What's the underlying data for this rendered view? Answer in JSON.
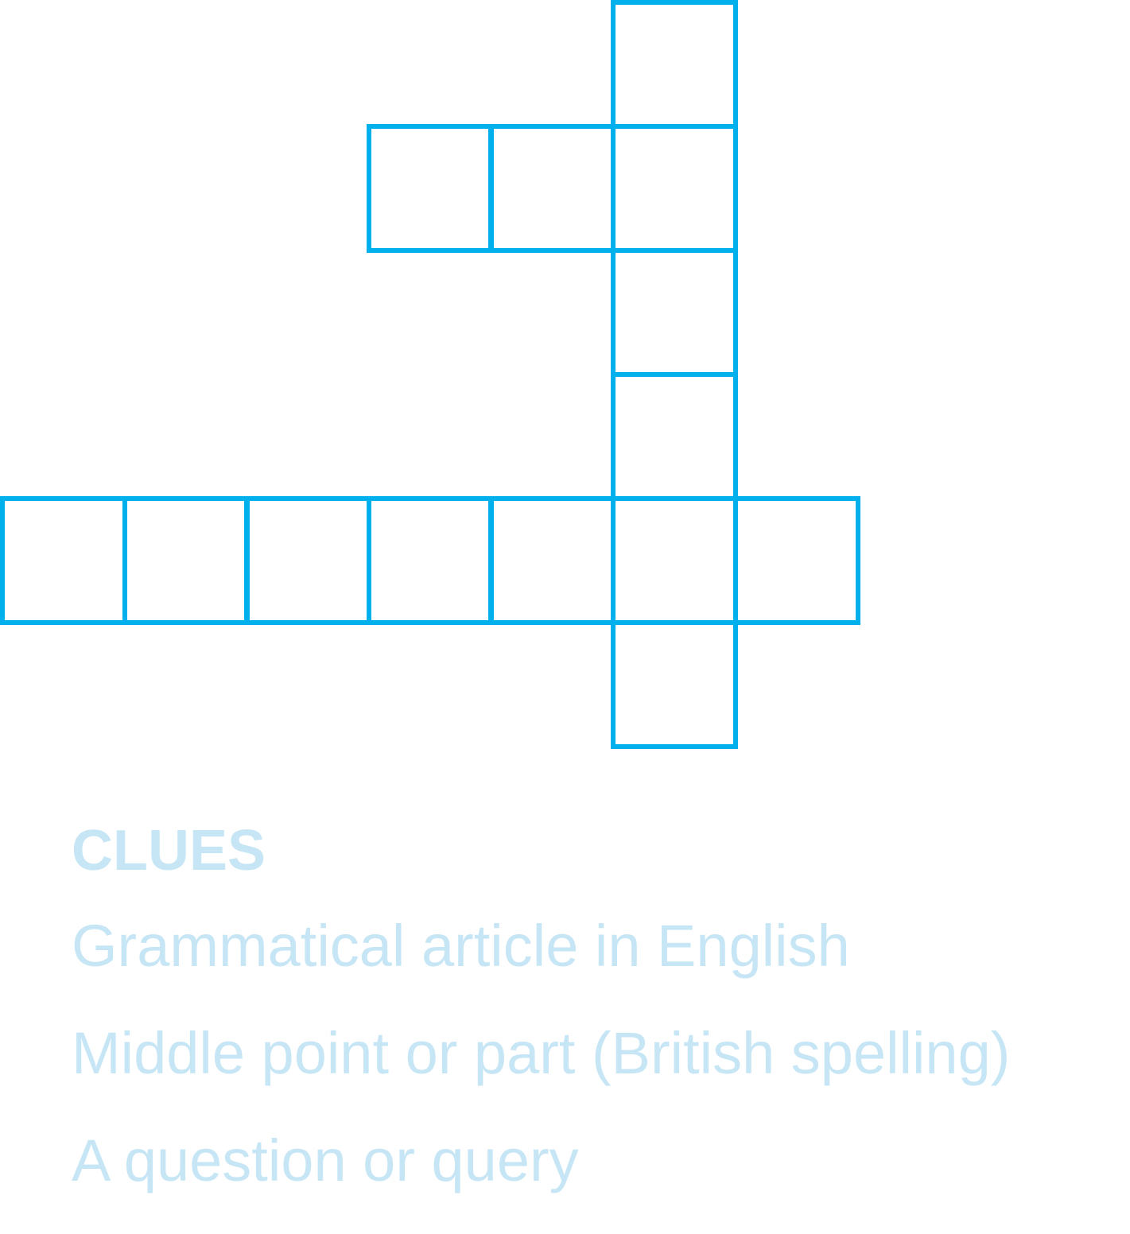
{
  "puzzle": {
    "grid_color": "#00b0ec",
    "text_color": "#c7e6f5",
    "cells": [
      {
        "row": 0,
        "col": 5
      },
      {
        "row": 1,
        "col": 3
      },
      {
        "row": 1,
        "col": 4
      },
      {
        "row": 1,
        "col": 5
      },
      {
        "row": 2,
        "col": 5
      },
      {
        "row": 3,
        "col": 5
      },
      {
        "row": 4,
        "col": 0
      },
      {
        "row": 4,
        "col": 1
      },
      {
        "row": 4,
        "col": 2
      },
      {
        "row": 4,
        "col": 3
      },
      {
        "row": 4,
        "col": 4
      },
      {
        "row": 4,
        "col": 5
      },
      {
        "row": 4,
        "col": 6
      },
      {
        "row": 5,
        "col": 5
      }
    ]
  },
  "clues": {
    "title": "CLUES",
    "items": [
      "Grammatical article in English",
      "Middle point or part (British spelling)",
      "A question or query"
    ]
  }
}
